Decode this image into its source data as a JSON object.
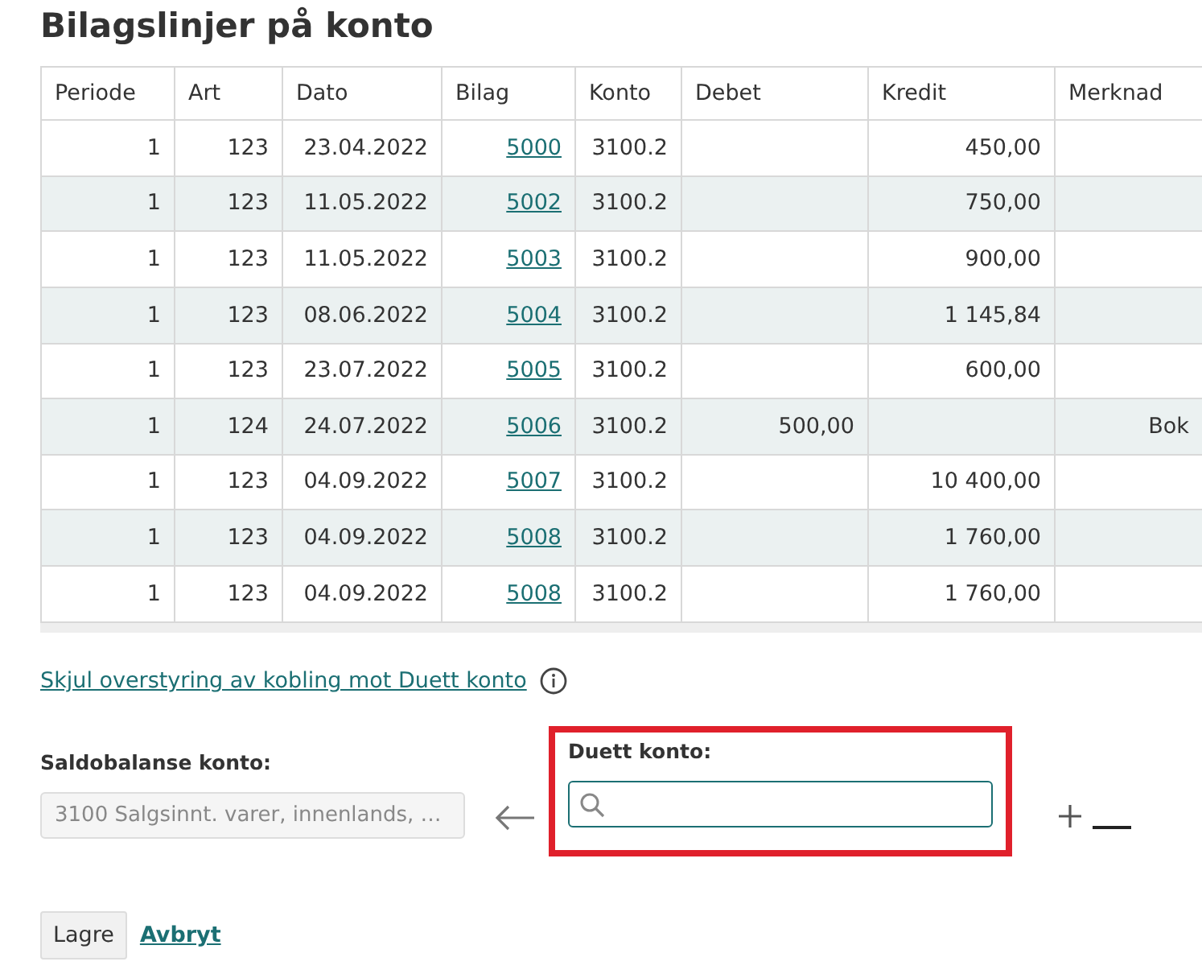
{
  "title": "Bilagslinjer på konto",
  "table": {
    "columns": [
      "Periode",
      "Art",
      "Dato",
      "Bilag",
      "Konto",
      "Debet",
      "Kredit",
      "Merknad"
    ],
    "rows": [
      {
        "periode": "1",
        "art": "123",
        "dato": "23.04.2022",
        "bilag": "5000",
        "konto": "3100.2",
        "debet": "",
        "kredit": "450,00",
        "merknad": ""
      },
      {
        "periode": "1",
        "art": "123",
        "dato": "11.05.2022",
        "bilag": "5002",
        "konto": "3100.2",
        "debet": "",
        "kredit": "750,00",
        "merknad": ""
      },
      {
        "periode": "1",
        "art": "123",
        "dato": "11.05.2022",
        "bilag": "5003",
        "konto": "3100.2",
        "debet": "",
        "kredit": "900,00",
        "merknad": ""
      },
      {
        "periode": "1",
        "art": "123",
        "dato": "08.06.2022",
        "bilag": "5004",
        "konto": "3100.2",
        "debet": "",
        "kredit": "1 145,84",
        "merknad": ""
      },
      {
        "periode": "1",
        "art": "123",
        "dato": "23.07.2022",
        "bilag": "5005",
        "konto": "3100.2",
        "debet": "",
        "kredit": "600,00",
        "merknad": ""
      },
      {
        "periode": "1",
        "art": "124",
        "dato": "24.07.2022",
        "bilag": "5006",
        "konto": "3100.2",
        "debet": "500,00",
        "kredit": "",
        "merknad": "Bok"
      },
      {
        "periode": "1",
        "art": "123",
        "dato": "04.09.2022",
        "bilag": "5007",
        "konto": "3100.2",
        "debet": "",
        "kredit": "10 400,00",
        "merknad": ""
      },
      {
        "periode": "1",
        "art": "123",
        "dato": "04.09.2022",
        "bilag": "5008",
        "konto": "3100.2",
        "debet": "",
        "kredit": "1 760,00",
        "merknad": ""
      },
      {
        "periode": "1",
        "art": "123",
        "dato": "04.09.2022",
        "bilag": "5008",
        "konto": "3100.2",
        "debet": "",
        "kredit": "1 760,00",
        "merknad": ""
      }
    ]
  },
  "toggle_link": "Skjul overstyring av kobling mot Duett konto",
  "saldo": {
    "label": "Saldobalanse konto:",
    "value": "3100 Salgsinnt. varer, innenlands, …",
    "disabled": true
  },
  "duett": {
    "label": "Duett konto:",
    "highlighted": true
  },
  "buttons": {
    "save": "Lagre",
    "cancel": "Avbryt"
  }
}
